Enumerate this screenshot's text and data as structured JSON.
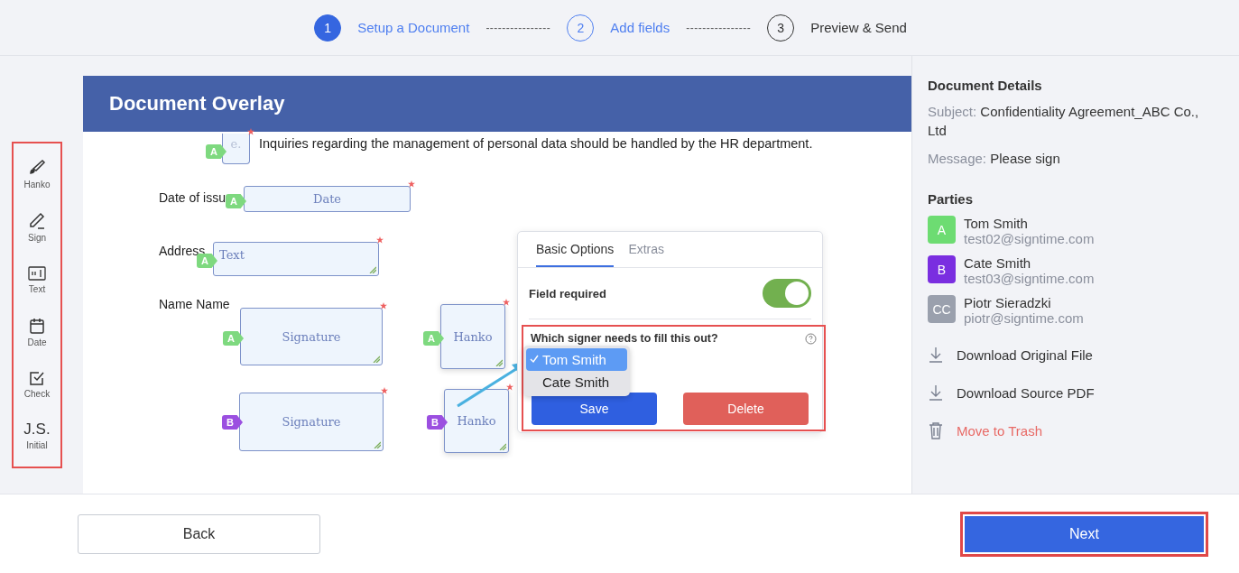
{
  "steps": [
    {
      "number": "1",
      "label": "Setup a Document",
      "completed": true,
      "current": false
    },
    {
      "number": "2",
      "label": "Add fields",
      "completed": false,
      "current": true
    },
    {
      "number": "3",
      "label": "Preview & Send",
      "completed": false,
      "current": false
    }
  ],
  "step_separator": "----------------",
  "toolbar": [
    {
      "kind": "hanko",
      "label": "Hanko"
    },
    {
      "kind": "sign",
      "label": "Sign"
    },
    {
      "kind": "text",
      "label": "Text"
    },
    {
      "kind": "date",
      "label": "Date"
    },
    {
      "kind": "check",
      "label": "Check"
    },
    {
      "kind": "initial",
      "label": "Initial",
      "icon_text": "J.S."
    }
  ],
  "document": {
    "title": "Document Overlay",
    "paragraph": "Inquiries regarding the management of personal data should be handled by the HR department.",
    "labels": [
      "Date of issu",
      "Address",
      "Name Name"
    ],
    "fields": [
      {
        "kind": "small",
        "placeholder": "e.",
        "signer": "A",
        "color": "#7ed97f",
        "required": true
      },
      {
        "kind": "date",
        "placeholder": "Date",
        "signer": "A",
        "color": "#7ed97f",
        "required": true
      },
      {
        "kind": "text",
        "placeholder": "Text",
        "signer": "A",
        "color": "#7ed97f",
        "required": true
      },
      {
        "kind": "signature",
        "placeholder": "Signature",
        "signer": "A",
        "color": "#7ed97f",
        "required": true
      },
      {
        "kind": "hanko",
        "placeholder": "Hanko",
        "signer": "A",
        "color": "#7ed97f",
        "required": true
      },
      {
        "kind": "signature",
        "placeholder": "Signature",
        "signer": "B",
        "color": "#9b4fe0",
        "required": true
      },
      {
        "kind": "hanko",
        "placeholder": "Hanko",
        "signer": "B",
        "color": "#9b4fe0",
        "required": true
      }
    ]
  },
  "popup": {
    "tabs": [
      {
        "label": "Basic Options",
        "selected": true
      },
      {
        "label": "Extras",
        "selected": false
      }
    ],
    "required_label": "Field required",
    "required_on": true,
    "question": "Which signer needs to fill this out?",
    "signer_options": [
      {
        "label": "Tom Smith",
        "selected": true
      },
      {
        "label": "Cate Smith",
        "selected": false
      }
    ],
    "save": "Save",
    "delete": "Delete"
  },
  "details": {
    "title": "Document Details",
    "subject_label": "Subject:",
    "subject": "Confidentiality Agreement_ABC Co., Ltd",
    "message_label": "Message:",
    "message": "Please sign",
    "parties_title": "Parties",
    "parties": [
      {
        "badge": "A",
        "name": "Tom Smith",
        "email": "test02@signtime.com",
        "color": "#6ddc72"
      },
      {
        "badge": "B",
        "name": "Cate Smith",
        "email": "test03@signtime.com",
        "color": "#7a2ee0"
      },
      {
        "badge": "CC",
        "name": "Piotr Sieradzki",
        "email": "piotr@signtime.com",
        "color": "#9aa0ad"
      }
    ],
    "actions": [
      {
        "kind": "download",
        "label": "Download Original File"
      },
      {
        "kind": "download",
        "label": "Download Source PDF"
      },
      {
        "kind": "trash",
        "label": "Move to Trash"
      }
    ]
  },
  "back": "Back",
  "next": "Next"
}
